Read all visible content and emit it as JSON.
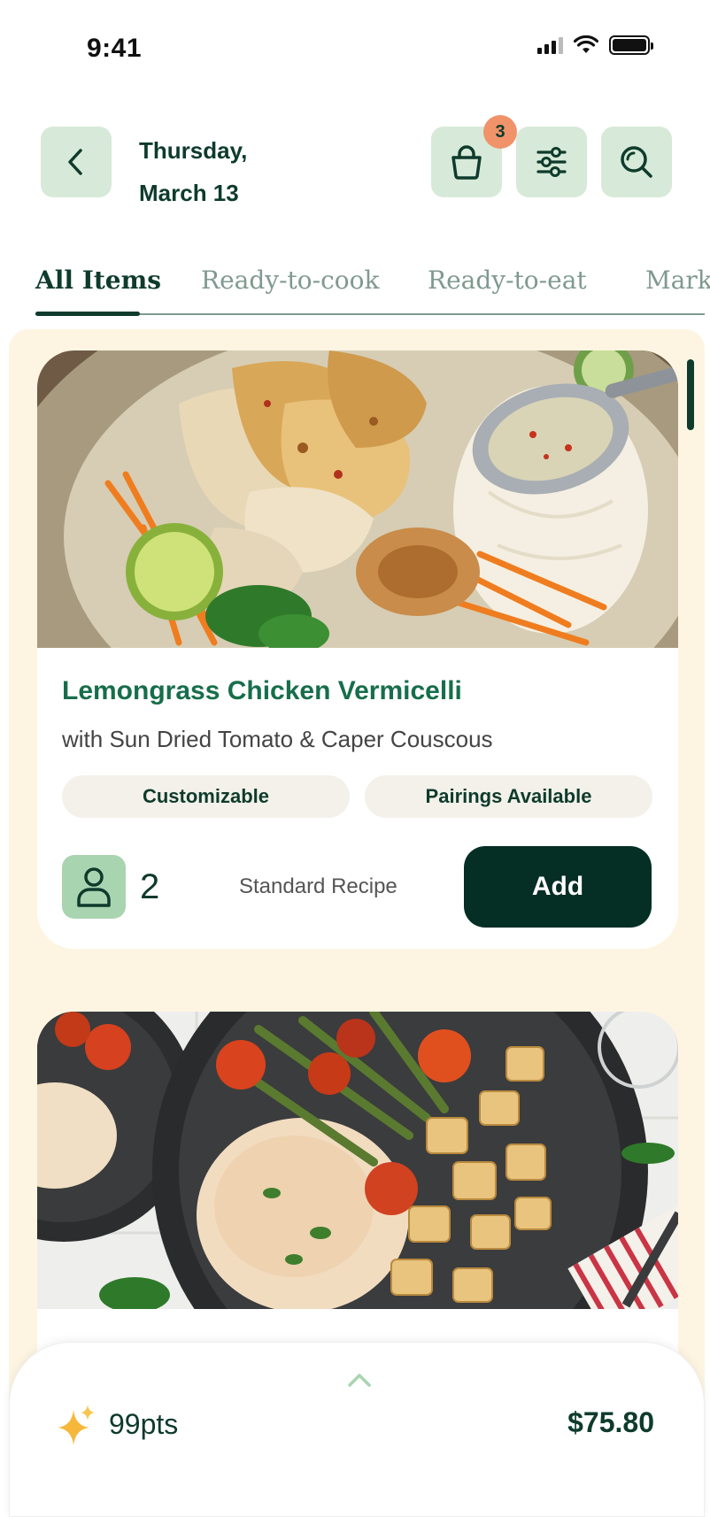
{
  "status_bar": {
    "time": "9:41"
  },
  "header": {
    "date_line1": "Thursday,",
    "date_line2": "March 13",
    "cart_badge_count": "3"
  },
  "tabs": [
    {
      "label": "All Items",
      "active": true
    },
    {
      "label": "Ready-to-cook",
      "active": false
    },
    {
      "label": "Ready-to-eat",
      "active": false
    },
    {
      "label": "Mark",
      "active": false
    }
  ],
  "recipes": [
    {
      "title": "Lemongrass Chicken Vermicelli",
      "subtitle": "with Sun Dried Tomato & Caper Couscous",
      "tags": [
        "Customizable",
        "Pairings Available"
      ],
      "servings": "2",
      "recipe_type": "Standard Recipe",
      "add_label": "Add"
    },
    {
      "title": "",
      "subtitle": ""
    }
  ],
  "summary": {
    "points": "99pts",
    "total": "$75.80"
  },
  "colors": {
    "primary_dark": "#0e3b2c",
    "accent_green": "#176e4a",
    "button_bg_light": "#d7e9d8",
    "badge": "#f0936a",
    "content_bg": "#fdf5e2",
    "add_button": "#052e24"
  },
  "icons": [
    "back-chevron-icon",
    "basket-icon",
    "sliders-icon",
    "search-icon",
    "person-icon",
    "sparkle-icon",
    "chevron-up-icon"
  ]
}
